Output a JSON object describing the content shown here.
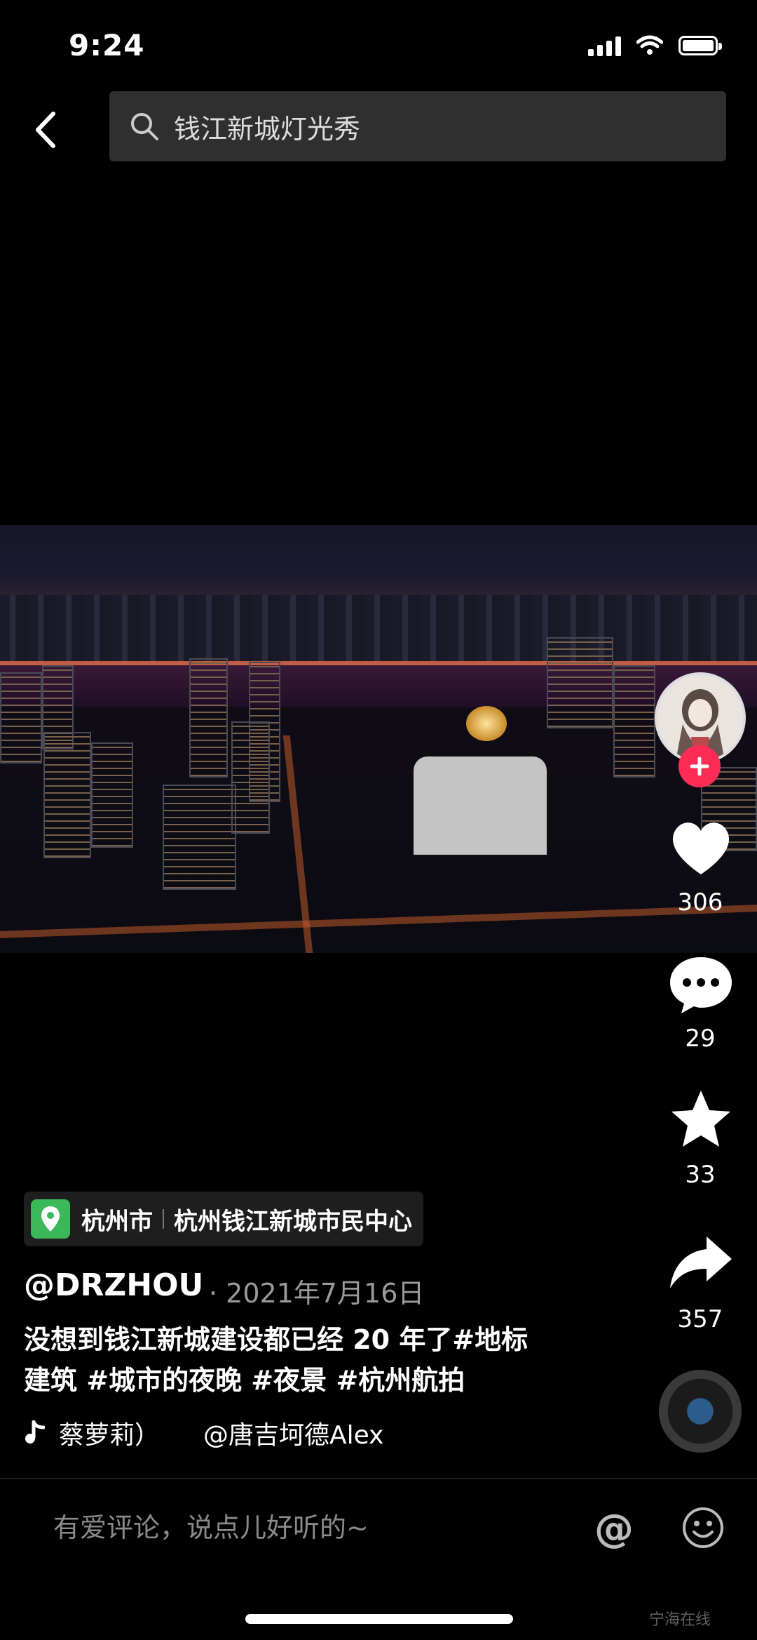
{
  "status": {
    "time": "9:24"
  },
  "search": {
    "query": "钱江新城灯光秀"
  },
  "rail": {
    "likes": "306",
    "comments": "29",
    "favorites": "33",
    "shares": "357"
  },
  "location": {
    "city": "杭州市",
    "place": "杭州钱江新城市民中心"
  },
  "post": {
    "author": "@DRZHOU",
    "date": "· 2021年7月16日",
    "line1": "没想到钱江新城建设都已经 20 年了#地标",
    "line2": "建筑 #城市的夜晚 #夜景 #杭州航拍"
  },
  "music": {
    "name": "蔡萝莉）",
    "artist": "@唐吉坷德Alex"
  },
  "comment": {
    "placeholder": "有爱评论，说点儿好听的~",
    "at": "@"
  },
  "watermark": "宁海在线",
  "colors": {
    "follow": "#fe2c55",
    "pin": "#3bb85a",
    "background": "#000000"
  }
}
